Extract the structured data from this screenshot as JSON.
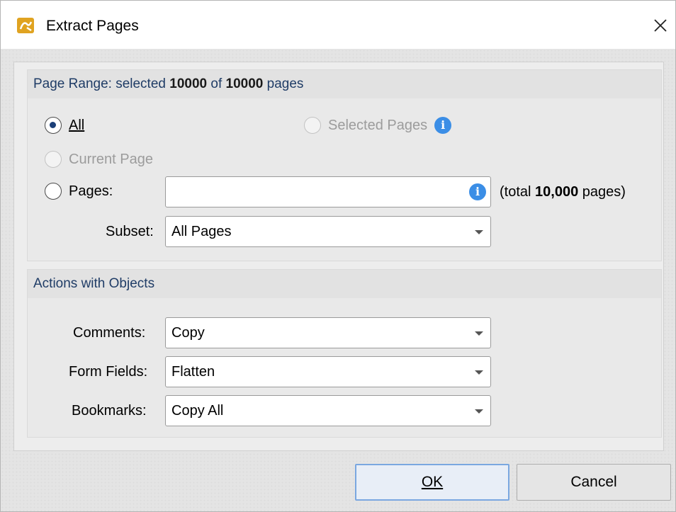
{
  "window": {
    "title": "Extract Pages"
  },
  "page_range": {
    "title_prefix": "Page Range: selected ",
    "selected_count": "10000",
    "title_of": " of ",
    "total_count": "10000",
    "title_suffix": " pages",
    "options": {
      "all": "All",
      "selected_pages": "Selected Pages",
      "current_page": "Current Page",
      "pages": "Pages:"
    },
    "pages_input": {
      "value": ""
    },
    "total_prefix": "(total ",
    "total_value": "10,000",
    "total_suffix": " pages)",
    "subset_label": "Subset:",
    "subset_value": "All Pages"
  },
  "actions": {
    "title": "Actions with Objects",
    "comments_label": "Comments:",
    "comments_value": "Copy",
    "form_fields_label": "Form Fields:",
    "form_fields_value": "Flatten",
    "bookmarks_label": "Bookmarks:",
    "bookmarks_value": "Copy All"
  },
  "buttons": {
    "ok": "OK",
    "cancel": "Cancel"
  },
  "colors": {
    "accent": "#1b3f78",
    "info": "#3b8ee6",
    "app_icon": "#e0a321"
  }
}
